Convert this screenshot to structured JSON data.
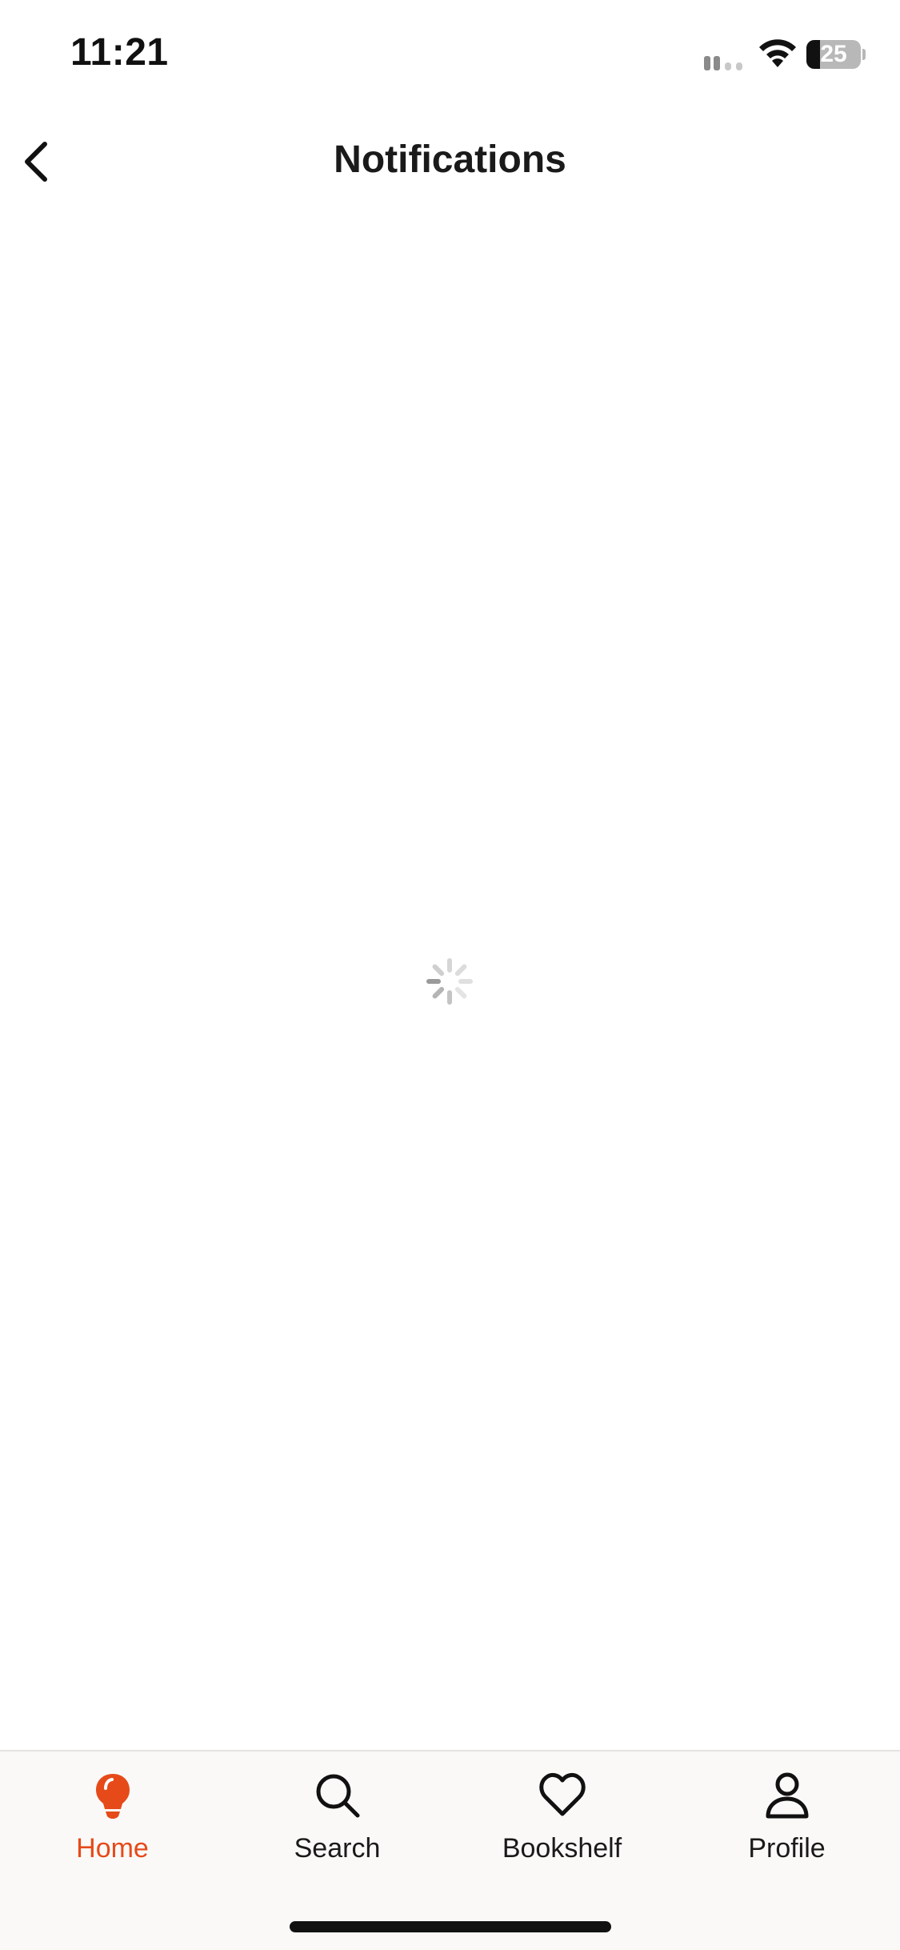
{
  "status_bar": {
    "time": "11:21",
    "battery_percent": "25",
    "battery_level": 0.25,
    "icons": [
      "cellular-signal-icon",
      "wifi-icon",
      "battery-icon"
    ]
  },
  "header": {
    "title": "Notifications",
    "back_icon": "chevron-left-icon"
  },
  "content": {
    "state": "loading",
    "spinner_icon": "loading-spinner-icon"
  },
  "tab_bar": {
    "accent_color": "#e64a19",
    "tabs": [
      {
        "label": "Home",
        "icon": "lightbulb-icon",
        "active": true
      },
      {
        "label": "Search",
        "icon": "search-icon",
        "active": false
      },
      {
        "label": "Bookshelf",
        "icon": "heart-icon",
        "active": false
      },
      {
        "label": "Profile",
        "icon": "person-icon",
        "active": false
      }
    ]
  }
}
